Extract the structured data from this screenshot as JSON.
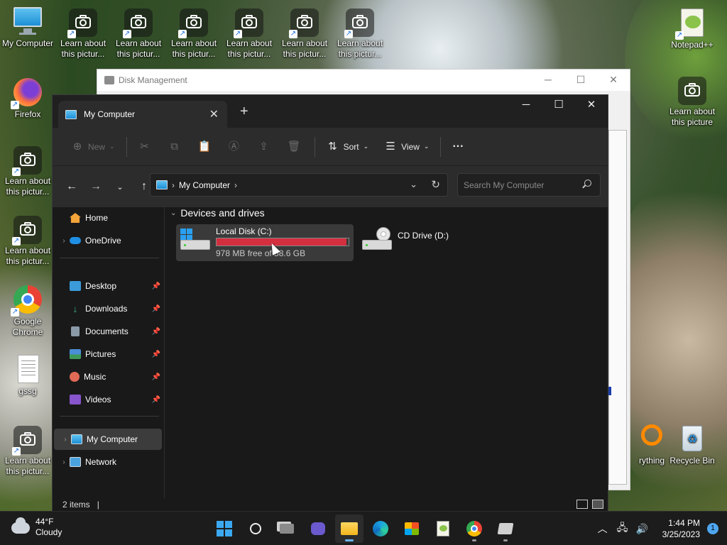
{
  "desktop": {
    "icons": [
      {
        "label": "My Computer"
      },
      {
        "label": "Learn about this pictur..."
      },
      {
        "label": "Learn about this pictur..."
      },
      {
        "label": "Learn about this pictur..."
      },
      {
        "label": "Learn about this pictur..."
      },
      {
        "label": "Learn about this pictur..."
      },
      {
        "label": "Learn about this pictur..."
      },
      {
        "label": "Notepad++"
      },
      {
        "label": "Firefox"
      },
      {
        "label": "Learn about this picture"
      },
      {
        "label": "Learn about this pictur..."
      },
      {
        "label": "Learn about this pictur..."
      },
      {
        "label": "Google Chrome"
      },
      {
        "label": "gssg"
      },
      {
        "label": "Learn about this pictur..."
      },
      {
        "label": "rything"
      },
      {
        "label": "Recycle Bin"
      }
    ]
  },
  "disk_management": {
    "title": "Disk Management"
  },
  "explorer": {
    "tab_title": "My Computer",
    "toolbar": {
      "new_label": "New",
      "sort_label": "Sort",
      "view_label": "View",
      "more_label": "···"
    },
    "address": {
      "crumb": "My Computer",
      "search_placeholder": "Search My Computer"
    },
    "nav": {
      "home": "Home",
      "onedrive": "OneDrive",
      "quick": [
        {
          "label": "Desktop",
          "color": "#3b9ad9"
        },
        {
          "label": "Downloads",
          "color": "#3fb27f"
        },
        {
          "label": "Documents",
          "color": "#8a9aa8"
        },
        {
          "label": "Pictures",
          "color": "#4a8fd6"
        },
        {
          "label": "Music",
          "color": "#e06a55"
        },
        {
          "label": "Videos",
          "color": "#8855cc"
        }
      ],
      "my_computer": "My Computer",
      "network": "Network"
    },
    "content": {
      "section_title": "Devices and drives",
      "drives": [
        {
          "name": "Local Disk (C:)",
          "free_text": "978 MB free of 58.6 GB",
          "used_fraction": 0.983
        },
        {
          "name": "CD Drive (D:)"
        }
      ]
    },
    "status": {
      "items_text": "2 items",
      "cursor": "|"
    }
  },
  "taskbar": {
    "weather_temp": "44°F",
    "weather_cond": "Cloudy",
    "time": "1:44 PM",
    "date": "3/25/2023",
    "notification_count": "1"
  }
}
